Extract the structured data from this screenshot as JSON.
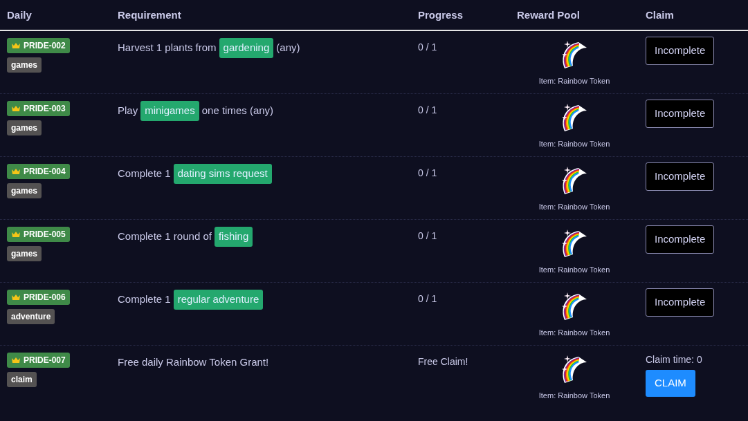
{
  "columns": [
    "Daily",
    "Requirement",
    "Progress",
    "Reward Pool",
    "Claim"
  ],
  "rows": [
    {
      "id": "PRIDE-002",
      "category": "games",
      "requirement": [
        {
          "kind": "text",
          "text": "Harvest 1 plants from"
        },
        {
          "kind": "tag",
          "text": "gardening"
        },
        {
          "kind": "text",
          "text": "(any)"
        }
      ],
      "progress": "0 / 1",
      "reward": "Item: Rainbow Token",
      "claim": {
        "kind": "status",
        "label": "Incomplete"
      }
    },
    {
      "id": "PRIDE-003",
      "category": "games",
      "requirement": [
        {
          "kind": "text",
          "text": "Play"
        },
        {
          "kind": "tag",
          "text": "minigames"
        },
        {
          "kind": "text",
          "text": "one times (any)"
        }
      ],
      "progress": "0 / 1",
      "reward": "Item: Rainbow Token",
      "claim": {
        "kind": "status",
        "label": "Incomplete"
      }
    },
    {
      "id": "PRIDE-004",
      "category": "games",
      "requirement": [
        {
          "kind": "text",
          "text": "Complete 1"
        },
        {
          "kind": "tag",
          "text": "dating sims request"
        }
      ],
      "progress": "0 / 1",
      "reward": "Item: Rainbow Token",
      "claim": {
        "kind": "status",
        "label": "Incomplete"
      }
    },
    {
      "id": "PRIDE-005",
      "category": "games",
      "requirement": [
        {
          "kind": "text",
          "text": "Complete 1 round of"
        },
        {
          "kind": "tag",
          "text": "fishing"
        }
      ],
      "progress": "0 / 1",
      "reward": "Item: Rainbow Token",
      "claim": {
        "kind": "status",
        "label": "Incomplete"
      }
    },
    {
      "id": "PRIDE-006",
      "category": "adventure",
      "requirement": [
        {
          "kind": "text",
          "text": "Complete 1"
        },
        {
          "kind": "tag",
          "text": "regular adventure"
        }
      ],
      "progress": "0 / 1",
      "reward": "Item: Rainbow Token",
      "claim": {
        "kind": "status",
        "label": "Incomplete"
      }
    },
    {
      "id": "PRIDE-007",
      "category": "claim",
      "requirement": [
        {
          "kind": "text",
          "text": "Free daily Rainbow Token Grant!"
        }
      ],
      "progress": "Free Claim!",
      "reward": "Item: Rainbow Token",
      "claim": {
        "kind": "action",
        "time": "Claim time: 0",
        "label": "CLAIM"
      }
    }
  ]
}
